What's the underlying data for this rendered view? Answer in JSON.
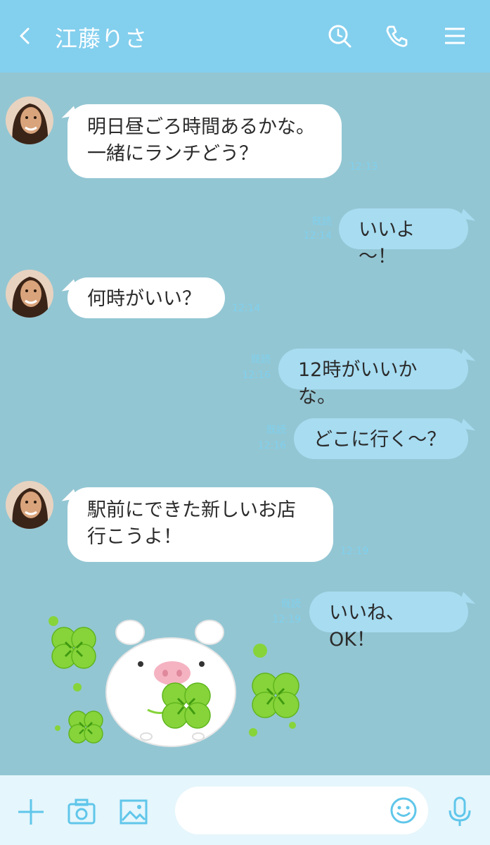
{
  "header": {
    "title": "江藤りさ",
    "bg_color": "#83cfee",
    "icons": [
      "back-icon",
      "search-icon",
      "phone-icon",
      "menu-icon"
    ]
  },
  "chat": {
    "bg_color": "#93c6d3",
    "messages": [
      {
        "side": "left",
        "lines": [
          "明日昼ごろ時間あるかな。",
          "一緒にランチどう？"
        ],
        "time": "12:13"
      },
      {
        "side": "right",
        "text": "いいよ～！",
        "read": "既読",
        "time": "12:14"
      },
      {
        "side": "left",
        "text": "何時がいい？",
        "time": "12:14"
      },
      {
        "side": "right",
        "text": "12時がいいかな。",
        "read": "既読",
        "time": "12:16"
      },
      {
        "side": "right",
        "text": "どこに行く～？",
        "read": "既読",
        "time": "12:16"
      },
      {
        "side": "left",
        "lines": [
          "駅前にできた新しいお店",
          "行こうよ！"
        ],
        "time": "12:19"
      },
      {
        "side": "right",
        "text": "いいね、OK！",
        "read": "既読",
        "time": "12:19"
      }
    ],
    "sticker": "pig-with-clover-sticker"
  },
  "bottom_bar": {
    "icons": [
      "plus-icon",
      "camera-icon",
      "image-icon",
      "emoji-icon",
      "mic-icon"
    ],
    "input_placeholder": "",
    "accent": "#60c6ea"
  }
}
